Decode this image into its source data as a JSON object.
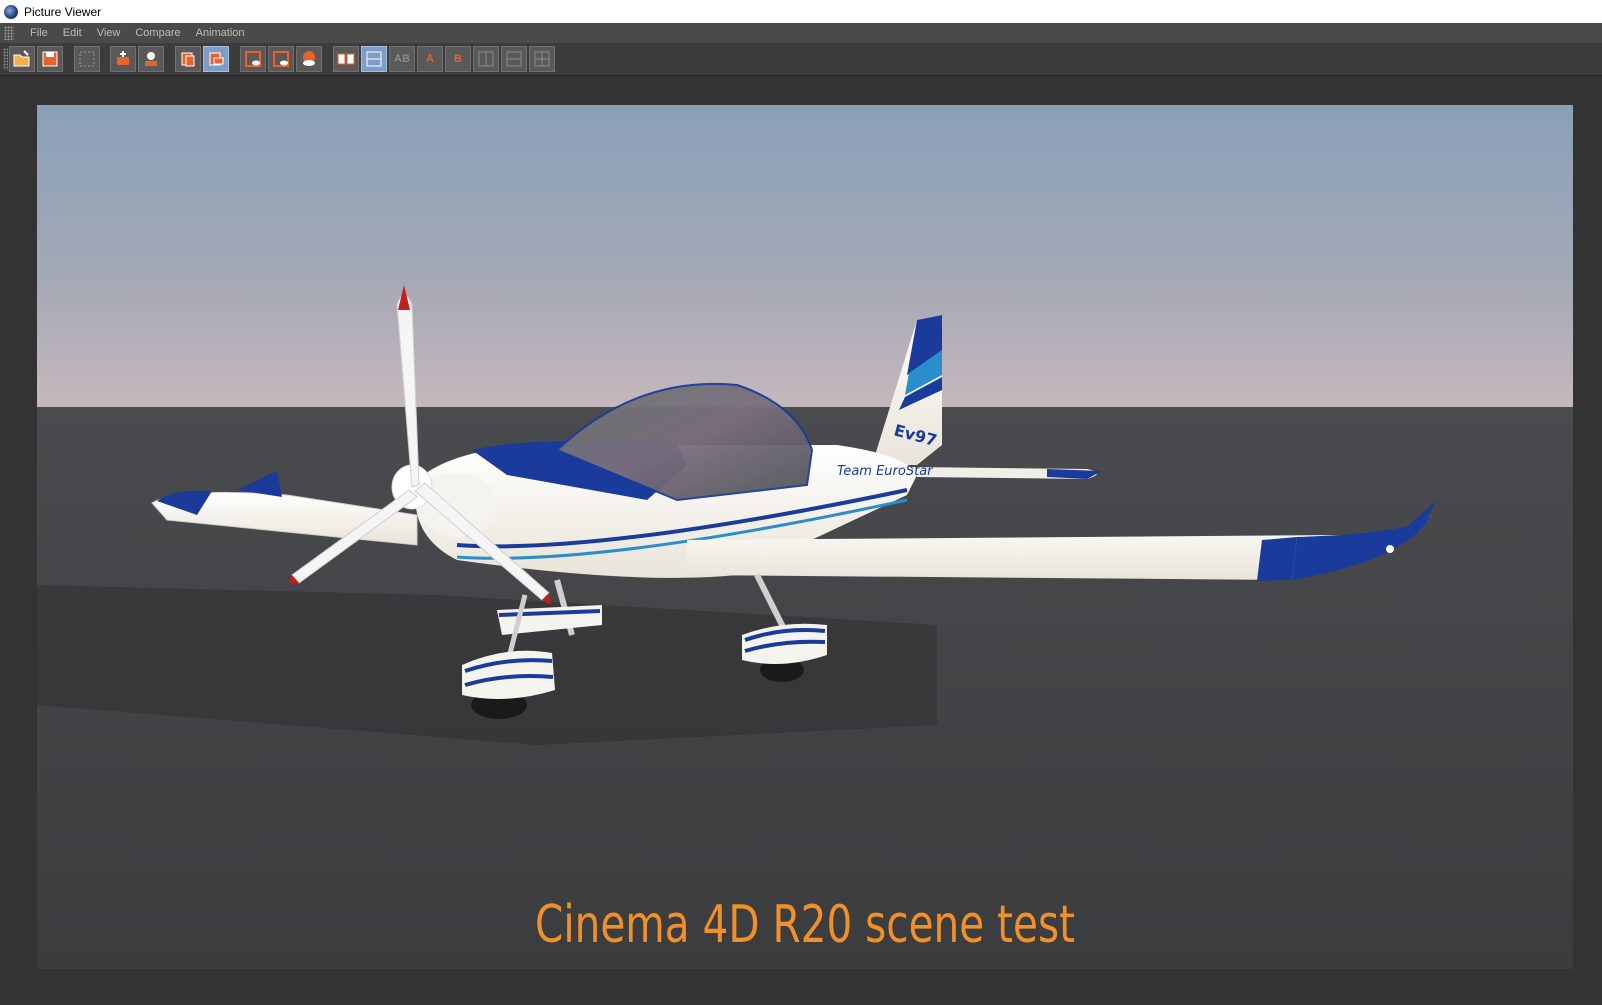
{
  "window": {
    "title": "Picture Viewer"
  },
  "menu": {
    "items": [
      "File",
      "Edit",
      "View",
      "Compare",
      "Animation"
    ]
  },
  "toolbar": {
    "buttons": [
      {
        "name": "open-icon"
      },
      {
        "name": "save-icon"
      },
      {
        "name": "grid-icon"
      },
      {
        "name": "fit-icon"
      },
      {
        "name": "user-icon"
      },
      {
        "name": "layers-icon"
      },
      {
        "name": "layers-active-icon",
        "active": true
      },
      {
        "name": "frame-eye-icon"
      },
      {
        "name": "frame-eye-2-icon"
      },
      {
        "name": "render-eye-icon"
      },
      {
        "name": "ab-icon"
      },
      {
        "name": "ab-active-icon",
        "active": true
      },
      {
        "name": "ab-disabled-icon",
        "label": "AB",
        "disabled": true
      },
      {
        "name": "set-a-icon",
        "label": "A"
      },
      {
        "name": "set-b-icon",
        "label": "B"
      },
      {
        "name": "compare-1-icon",
        "disabled": true
      },
      {
        "name": "compare-2-icon",
        "disabled": true
      },
      {
        "name": "compare-3-icon",
        "disabled": true
      }
    ]
  },
  "render": {
    "caption": "Cinema 4D R20 scene test",
    "tail_text": "Ev97",
    "fuselage_text": "Team EuroStar",
    "caption_color": "#f0902a"
  }
}
